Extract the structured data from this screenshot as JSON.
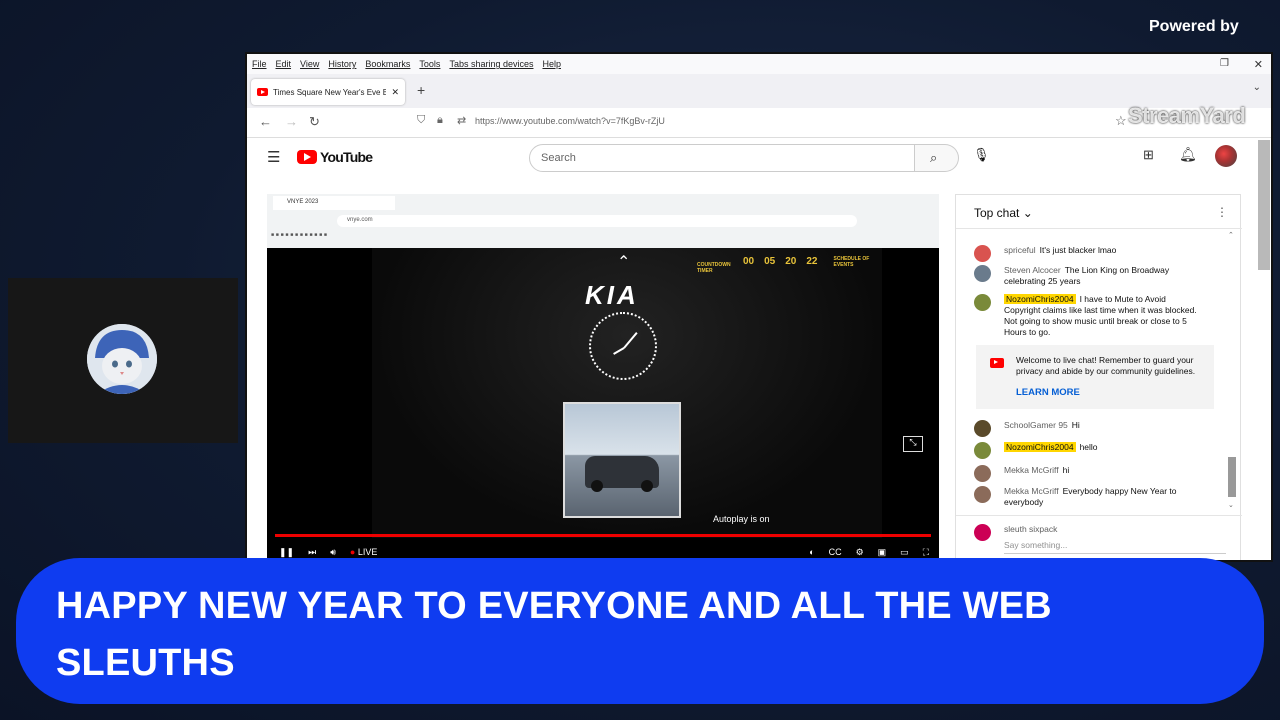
{
  "overlay": {
    "powered_by": "Powered by",
    "brand": "StreamYard",
    "banner": "HAPPY NEW YEAR TO EVERYONE AND ALL THE WEB SLEUTHS"
  },
  "browser": {
    "menu": [
      "File",
      "Edit",
      "View",
      "History",
      "Bookmarks",
      "Tools",
      "Tabs sharing devices",
      "Help"
    ],
    "tab_title": "Times Square New Year's Eve B",
    "url": "https://www.youtube.com/watch?v=7fKgBv-rZjU"
  },
  "youtube": {
    "logo_text": "YouTube",
    "search_placeholder": "Search"
  },
  "video": {
    "inner_tab": "VNYE 2023",
    "inner_url": "vnye.com",
    "brand": "KIA",
    "countdown_label": "COUNTDOWN TIMER",
    "days": "00",
    "hours": "05",
    "mins": "20",
    "sec": "22",
    "schedule": "SCHEDULE OF EVENTS",
    "autoplay": "Autoplay is on",
    "live": "LIVE"
  },
  "chat": {
    "header": "Top chat",
    "messages": [
      {
        "author": "spriceful",
        "text": "It's just blacker lmao",
        "highlight": false,
        "color": "#d9534f"
      },
      {
        "author": "Steven Alcocer",
        "text": "The Lion King on Broadway celebrating 25 years",
        "highlight": false,
        "color": "#6a7b8c"
      },
      {
        "author": "NozomiChris2004",
        "text": "I have to Mute to Avoid Copyright claims like last time when it was blocked. Not going to show music until break or close to 5 Hours to go.",
        "highlight": true,
        "color": "#7a8a3a"
      }
    ],
    "notice_text": "Welcome to live chat! Remember to guard your privacy and abide by our community guidelines.",
    "notice_link": "LEARN MORE",
    "messages2": [
      {
        "author": "SchoolGamer 95",
        "text": "Hi",
        "highlight": false,
        "color": "#5a4a2a"
      },
      {
        "author": "NozomiChris2004",
        "text": "hello",
        "highlight": true,
        "color": "#7a8a3a"
      },
      {
        "author": "Mekka McGriff",
        "text": "hi",
        "highlight": false,
        "color": "#8b6b5a"
      },
      {
        "author": "Mekka McGriff",
        "text": "Everybody happy New Year to everybody",
        "highlight": false,
        "color": "#8b6b5a"
      }
    ],
    "input_author": "sleuth sixpack",
    "input_placeholder": "Say something..."
  }
}
